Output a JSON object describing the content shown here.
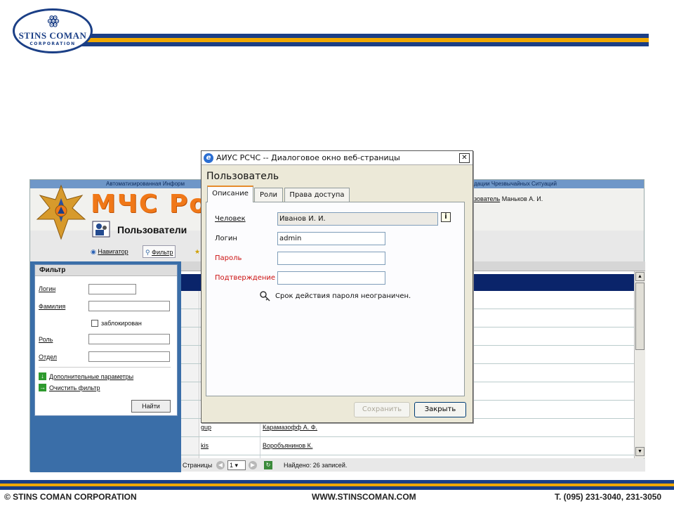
{
  "slide": {
    "logo_name": "STINS COMAN",
    "logo_sub": "CORPORATION",
    "footer_left": "© STINS COMAN CORPORATION",
    "footer_mid": "WWW.STINSCOMAN.COM",
    "footer_right": "T. (095) 231-3040, 231-3050",
    "colors": {
      "brand_blue": "#1b3f86",
      "brand_gold": "#f0a800"
    }
  },
  "app": {
    "header_bar_text_left": "Автоматизированная Информ",
    "header_bar_text_right": "дации Чрезвычайных Ситуаций",
    "mchs_title": "МЧС Ро",
    "page_title": "Пользователи",
    "current_user_link": "зователь",
    "current_user_name": "Маньков А. И.",
    "toolbar": {
      "navigator_label": "Навигатор",
      "filter_label": "Фильтр"
    },
    "filter": {
      "heading": "Фильтр",
      "login_label": "Логин",
      "surname_label": "Фамилия",
      "blocked_label": "заблокирован",
      "role_label": "Роль",
      "dept_label": "Отдел",
      "more_params_link": "Дополнительные параметры",
      "clear_filter_link": "Очистить фильтр",
      "find_button": "Найти"
    },
    "grid": {
      "rows": [
        {
          "login": "gup",
          "name": "Карамазофф А. Ф."
        },
        {
          "login": "kis",
          "name": "Воробъянинов К."
        }
      ]
    },
    "pager": {
      "label": "Страницы",
      "page": "1",
      "found": "Найдено: 26 записей."
    }
  },
  "dialog": {
    "title": "АИУС РСЧС -- Диалоговое окно веб-страницы",
    "heading": "Пользователь",
    "tabs": [
      "Описание",
      "Роли",
      "Права доступа"
    ],
    "active_tab": 0,
    "fields": {
      "person_label": "Человек",
      "person_value": "Иванов И. И.",
      "login_label": "Логин",
      "login_value": "admin",
      "password_label": "Пароль",
      "password_value": "",
      "confirm_label": "Подтверждение",
      "confirm_value": ""
    },
    "password_note": "Срок действия пароля неограничен.",
    "save_button": "Сохранить",
    "close_button": "Закрыть",
    "colors": {
      "required_label": "#cc1111",
      "tab_accent": "#e68b2c"
    }
  }
}
